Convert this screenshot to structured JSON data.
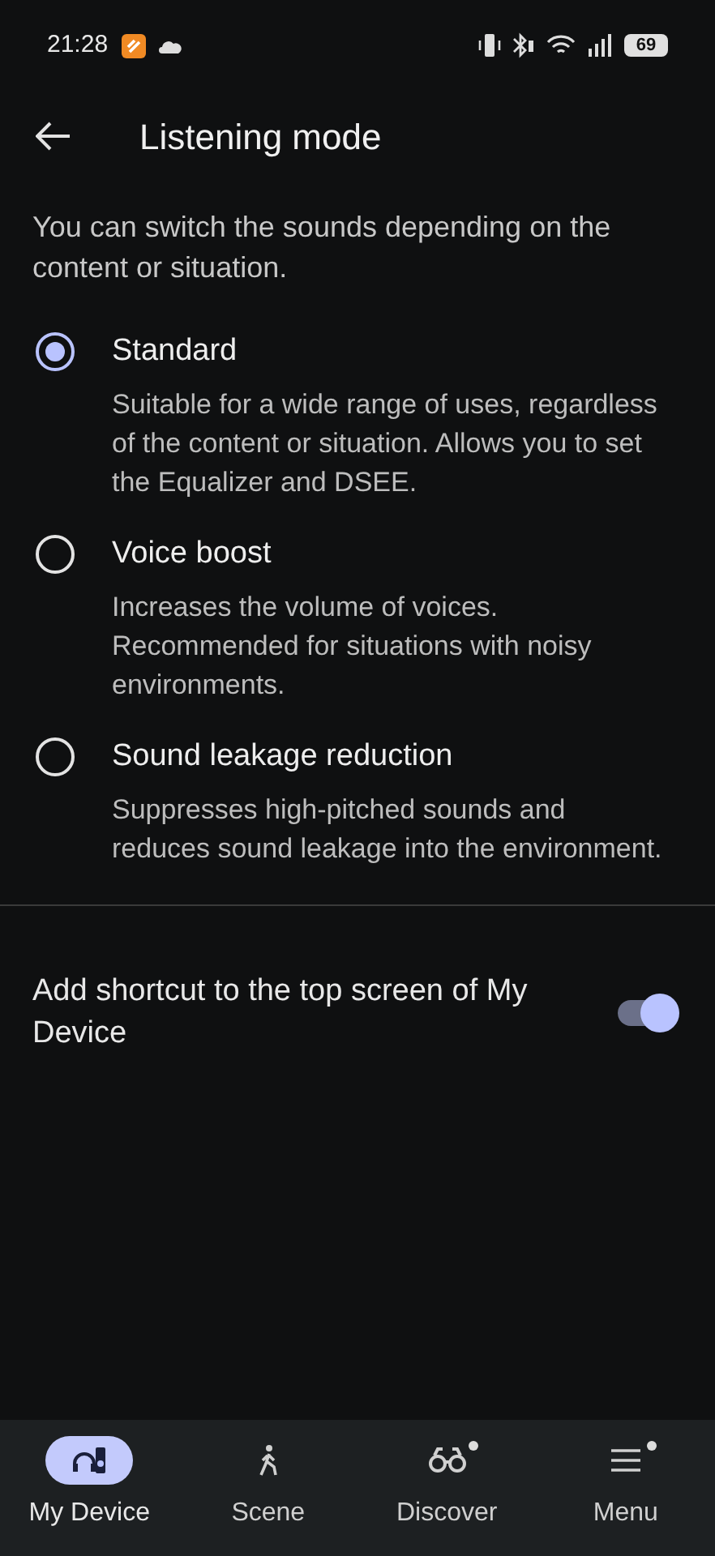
{
  "status_bar": {
    "time": "21:28",
    "battery": "69"
  },
  "header": {
    "title": "Listening mode"
  },
  "intro": "You can switch the sounds depending on the content or situation.",
  "options": [
    {
      "label": "Standard",
      "description": "Suitable for a wide range of uses, regardless of the content or situation. Allows you to set the Equalizer and DSEE.",
      "selected": true
    },
    {
      "label": "Voice boost",
      "description": "Increases the volume of voices. Recommended for situations with noisy environments.",
      "selected": false
    },
    {
      "label": "Sound leakage reduction",
      "description": "Suppresses high-pitched sounds and reduces sound leakage into the environment.",
      "selected": false
    }
  ],
  "shortcut": {
    "label": "Add shortcut to the top screen of My Device",
    "on": true
  },
  "bottom_nav": [
    {
      "label": "My Device",
      "selected": true,
      "badge": false
    },
    {
      "label": "Scene",
      "selected": false,
      "badge": false
    },
    {
      "label": "Discover",
      "selected": false,
      "badge": true
    },
    {
      "label": "Menu",
      "selected": false,
      "badge": true
    }
  ]
}
